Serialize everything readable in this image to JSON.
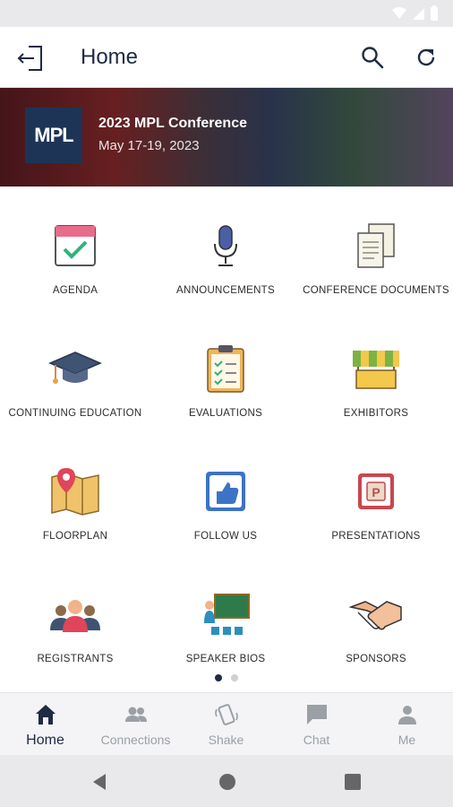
{
  "app_bar": {
    "title": "Home"
  },
  "banner": {
    "logo_text": "MPL",
    "event_name": "2023 MPL Conference",
    "event_dates": "May 17-19, 2023"
  },
  "tiles": [
    {
      "label": "AGENDA",
      "icon": "calendar-check-icon"
    },
    {
      "label": "ANNOUNCEMENTS",
      "icon": "microphone-icon"
    },
    {
      "label": "CONFERENCE DOCUMENTS",
      "icon": "documents-icon"
    },
    {
      "label": "CONTINUING EDUCATION",
      "icon": "graduation-cap-icon"
    },
    {
      "label": "EVALUATIONS",
      "icon": "clipboard-checklist-icon"
    },
    {
      "label": "EXHIBITORS",
      "icon": "booth-awning-icon"
    },
    {
      "label": "FLOORPLAN",
      "icon": "map-pin-icon"
    },
    {
      "label": "FOLLOW US",
      "icon": "thumbs-up-icon"
    },
    {
      "label": "PRESENTATIONS",
      "icon": "presentation-p-icon"
    },
    {
      "label": "REGISTRANTS",
      "icon": "people-group-icon"
    },
    {
      "label": "SPEAKER BIOS",
      "icon": "speaker-board-icon"
    },
    {
      "label": "SPONSORS",
      "icon": "handshake-icon"
    }
  ],
  "pager": {
    "pages": 2,
    "current": 1
  },
  "bottom_nav": [
    {
      "label": "Home",
      "icon": "home-icon",
      "active": true
    },
    {
      "label": "Connections",
      "icon": "people-icon",
      "active": false
    },
    {
      "label": "Shake",
      "icon": "shake-phone-icon",
      "active": false
    },
    {
      "label": "Chat",
      "icon": "chat-bubble-icon",
      "active": false
    },
    {
      "label": "Me",
      "icon": "person-icon",
      "active": false
    }
  ],
  "colors": {
    "primary": "#1f2a44",
    "nav_inactive": "#9aa0a6",
    "logo_bg": "#1e3457"
  }
}
